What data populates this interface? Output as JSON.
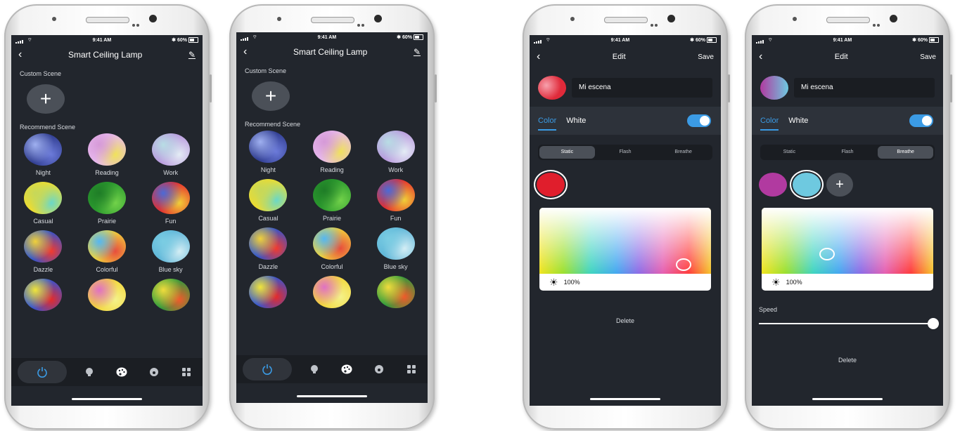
{
  "status": {
    "time": "9:41 AM",
    "battery": "60%"
  },
  "list": {
    "title": "Smart Ceiling Lamp",
    "custom_scene": "Custom Scene",
    "recommend_scene": "Recommend Scene",
    "scenes": [
      {
        "label": "Night",
        "colors": [
          "#2d3a8c",
          "#6b7ad9",
          "#9fb0f0"
        ]
      },
      {
        "label": "Reading",
        "colors": [
          "#e7b8ee",
          "#f0e25a",
          "#d69ad8"
        ]
      },
      {
        "label": "Work",
        "colors": [
          "#b898dd",
          "#e4ecf5",
          "#b8dde4"
        ]
      },
      {
        "label": "Casual",
        "colors": [
          "#f0dc2c",
          "#6ad8c8",
          "#c6d85a"
        ]
      },
      {
        "label": "Prairie",
        "colors": [
          "#2b9a2e",
          "#72d24a",
          "#1f7d27"
        ]
      },
      {
        "label": "Fun",
        "colors": [
          "#e52d2d",
          "#f1cf37",
          "#4c6ad6"
        ]
      },
      {
        "label": "Dazzle",
        "colors": [
          "#2c54d1",
          "#f33a2e",
          "#f0d03a"
        ]
      },
      {
        "label": "Colorful",
        "colors": [
          "#f0d33c",
          "#e84d3c",
          "#55b7f2"
        ]
      },
      {
        "label": "Blue sky",
        "colors": [
          "#5fb6d8",
          "#d4eef5",
          "#7bcde3"
        ]
      },
      {
        "label": "",
        "colors": [
          "#3154d4",
          "#e52b2b",
          "#f0e53a"
        ]
      },
      {
        "label": "",
        "colors": [
          "#f3d63a",
          "#f4f28a",
          "#e071c4"
        ]
      },
      {
        "label": "",
        "colors": [
          "#2b9b3c",
          "#f05a2b",
          "#f0dc3c"
        ]
      }
    ]
  },
  "edit1": {
    "title": "Edit",
    "save": "Save",
    "name": "Mi escena",
    "tab_color": "Color",
    "tab_white": "White",
    "modes": [
      "Static",
      "Flash",
      "Breathe"
    ],
    "active_mode": "Static",
    "brightness": "100%",
    "delete": "Delete",
    "preview_color": "#e02a3a",
    "swatch_color": "#e01e2c"
  },
  "edit2": {
    "title": "Edit",
    "save": "Save",
    "name": "Mi escena",
    "tab_color": "Color",
    "tab_white": "White",
    "modes": [
      "Static",
      "Flash",
      "Breathe"
    ],
    "active_mode": "Breathe",
    "brightness": "100%",
    "speed": "Speed",
    "speed_value": 1.0,
    "delete": "Delete",
    "swatch_colors": [
      "#b13aa0",
      "#6ec9e0"
    ]
  }
}
